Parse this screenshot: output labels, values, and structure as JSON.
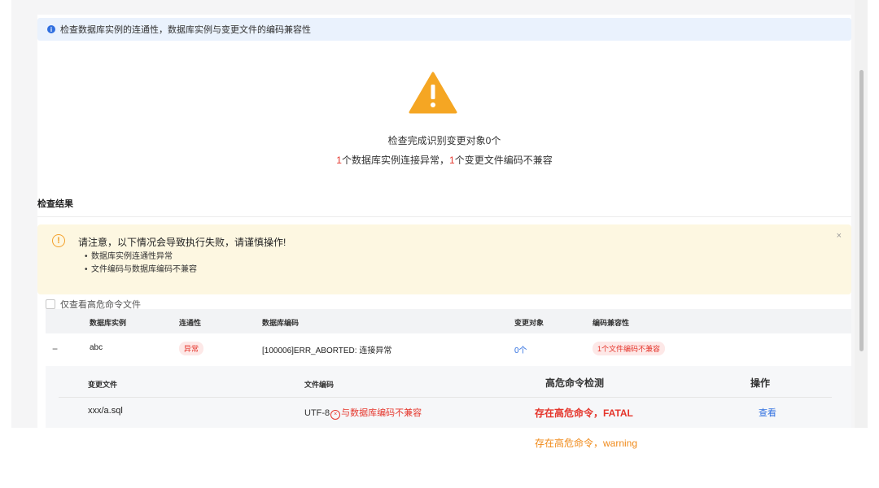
{
  "info": "检查数据库实例的连通性，数据库实例与变更文件的编码兼容性",
  "summary": {
    "line1": "检查完成识别变更对象0个",
    "line2_count1": "1",
    "line2_text1": "个数据库实例连接异常，",
    "line2_count2": "1",
    "line2_text2": "个变更文件编码不兼容"
  },
  "section_title": "检查结果",
  "alert": {
    "title": "请注意，以下情况会导致执行失败，请谨慎操作!",
    "items": [
      "数据库实例连通性异常",
      "文件编码与数据库编码不兼容"
    ],
    "close": "×"
  },
  "filter": {
    "label": "仅查看高危命令文件"
  },
  "table": {
    "headers": [
      "数据库实例",
      "连通性",
      "数据库编码",
      "变更对象",
      "编码兼容性"
    ],
    "rows": [
      {
        "expand": "−",
        "instance": "abc",
        "connectivity": "异常",
        "encoding": "[100006]ERR_ABORTED: 连接异常",
        "objects": "0个",
        "compat": "1个文件编码不兼容"
      }
    ]
  },
  "subtable": {
    "headers": [
      "变更文件",
      "文件编码",
      "高危命令检测",
      "操作"
    ],
    "rows": [
      {
        "file": "xxx/a.sql",
        "encoding": "UTF-8",
        "encoding_icon": "×",
        "encoding_warn": "与数据库编码不兼容",
        "danger": "存在高危命令，FATAL",
        "action": "查看"
      }
    ]
  },
  "warning_line": "存在高危命令，warning",
  "colors": {
    "accent": "#2f6fe0",
    "danger": "#e5352b",
    "warning": "#f3a02a"
  }
}
